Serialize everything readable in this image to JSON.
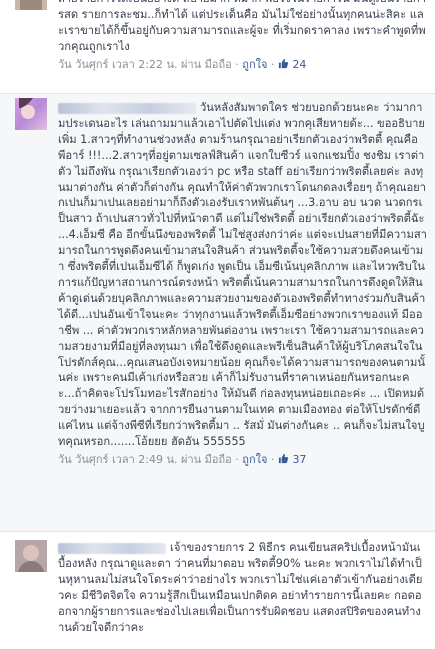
{
  "comments": [
    {
      "text": "ถ่ายรายการได้เป็นอย่างดี สบายมาก ดีมาก พอใจในรายการนี้ มันดูเป็นรายการสด รายการละชม..ก็ทำได้ แต่ประเด็นคือ มันไม่ใช่อย่างนั้นทุกคนน่ะสิคะ และเราขายได้ก็ขึ้นอยู่กับความสามารถและผู้จะ ที่เริ่มกดราคาลง เพราะคำพูดที่พวกคุณถูกเราไง",
      "day": "วัน วันศุกร์",
      "time_label": "เวลา 2:22 น.",
      "via": "ผ่าน มือถือ",
      "like_link": "ถูกใจ",
      "like_count": "24"
    },
    {
      "text": "วันหลังสัมพาดใคร ช่วยบอกด้วยนะคะ ว่ามากามประเดนอะไร เล่นถามมาแล้วเอาไปตัดไปแต่ง พวกคุเสียหายด้ะ... ขออธิบายเพิ่ม 1.สาวๆที่ทำงานช่วงหลัง ตามร้านกรุณาอย่าเรียกตัวเองว่าพริตตี้ คุณคือ พีอาร์ !!!...2.สาวๆที่อยู่ตามเซลฟ์สินค้า แจกใบซีวร์ แจกแชมปิ้ง ชงชิม เราต่าตัว ไม่ถึงพัน กรุณาเรียกตัวเองว่า pc หรือ staff อย่าเรียกว่าพริตตี้เลยค่ะ ลงทุนมาต่างกัน ค่าตัวก็ต่างกัน คุณทำให้ค่าตัวพวกเราโดนกดลงเรื่อยๆ ถ้าคุณอยากเปนก็มาเปนเลยอย่ามาก็ถึงตัวเองรับเราหพันต้นๆ ...3.อาบ อบ นวด นวดกรเป็นสาว ถ้าเปนสาวทั่วไปที่หน้าตาดี แต่ไม่ใช่พริตตี้ อย่าเรียกตัวเองว่าพริตตี้ฉัะ ...4.เอ็มซี คือ อีกขั้นนึงของพริตตี้ ไม่ใช่สูงส่งกว่าค่ะ แต่จะเปนสายที่มีความสามารถในการพูดดึงคนเข้ามาสนใจสินค้า ส่วนพริตตี้จะใช้ความสวยดึงคนเข้ามา ซึ่งพริตตี้ที่เปนเอ็มซีได้ ก็พูดเก่ง พูดเป็น เอ็มซีเน้นบุคลิกภาพ และไหวพริบในการแก้ปัญหาสถานการณ์ตรงหน้า พริตตี้เน้นความสามารถในการดึงดูดให้สินค้าดูเด่นด้วยบุคลิกภาพและความสวยงามของตัวเองพริตตี้ทำทางร่วมกับสินค้าได้ดี...เปนอันเข้าใจนะคะ ว่าทุกงานแล้วพริตตี้เอ็มซีอย่างพวกเราของแท้ มีออาชีพ ... ค่าตัวพวกเราหลักหลายพันต่องาน เพราะเรา ใช้ความสามารถและความสวยงามที่มีอยู่ที่ลงทุนมา เพื่อใช้ดึงดูดและพรีเซ็นสินค้าให้ผู้บริโภคสนใจในโปรดักส์คุณ...คุณเสนอบังเจหมายน้อย คุณก็จะได้ความสามารถของคนตามนั้นค่ะ เพราะคนมีเค้าเก่งหรือสวย เค้าก็ไม่รับงานที่ราคาเหน่อยกันหรอกนะคะ...ถ้าคิดจะโปรโมทอะไรสักอย่าง ให้มันดี ก่อลงทุนหน่อยเถอะค่ะ ... เปิดหมด้วยว่างมาเยอะแล้ว จากการยืนงานตามในเทค ตามเมืองทอง ต่อให้โปรดักซ์ดีแค่ไหน แต่จ้างพีซีที่เรียกว่าพริตตี้มา .. รัสมั่ มันต่างกันคะ .. คนก็จะไม่สนใจบูทคุณหรอก.......โอ้ยยย ฮัดอัน 555555",
      "day": "วัน วันศุกร์",
      "time_label": "เวลา 2:49 น.",
      "via": "ผ่าน มือถือ",
      "like_link": "ถูกใจ",
      "like_count": "37"
    },
    {
      "text": "เจ้าของรายการ 2 พิธีกร คนเขียนสคริปเบื้องหน้ามันเบื้องหลัง กรุณาดูและตา ว่าคนที่มาตอบ พริตตี้90% นะคะ พวกเราไม่ได้ทำเป็นหุหานลมไม่สนใจโดระค่าว่าอย่างไร พวกเราไม่ใช่แค่เอาตัวเข้ากันอย่างเดียวคะ มีชีวิตจิตใจ ความรู้สึกเป็นเหมือนเปกติดค อย่าทำรายการนี้เลยคะ กอดออกจากผู้รายการและช่องไปเลยเพื่อเป็นการรับผิดชอบ แสดงสปิริตของคนทำงานด้วยใจดีกว่าคะ"
    }
  ],
  "colors": {
    "link": "#3b5998",
    "meta": "#8a8d94",
    "text": "#37404e",
    "highlight_bg": "#f6f7f9"
  },
  "icons": {
    "like": "thumbs-up-icon",
    "avatar": "profile-photo"
  }
}
